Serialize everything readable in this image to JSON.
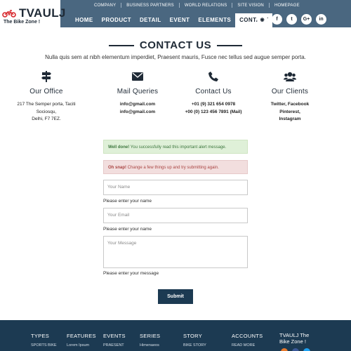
{
  "brand": {
    "name": "TVAULJ",
    "tagline": "The Bike Zone !",
    "brand_color": "#d7262b"
  },
  "top_nav": [
    "COMPANY",
    "BUSINESS PARTNERS",
    "WORLD RELATIONS",
    "SITE VISION",
    "HOMEPAGE"
  ],
  "main_nav": {
    "items": [
      "HOME",
      "PRODUCT",
      "DETAIL",
      "EVENT",
      "ELEMENTS",
      "CONTACT"
    ],
    "active": "CONTACT"
  },
  "social_icons": [
    {
      "name": "rss-icon",
      "glyph": "◉"
    },
    {
      "name": "facebook-icon",
      "glyph": "f"
    },
    {
      "name": "twitter-icon",
      "glyph": "t"
    },
    {
      "name": "google-plus-icon",
      "glyph": "G+"
    },
    {
      "name": "linkedin-icon",
      "glyph": "in"
    }
  ],
  "contact": {
    "title": "CONTACT US",
    "subtitle": "Nulla quis sem at nibh elementum imperdiet, Praesent mauris, Fusce nec tellus sed augue semper porta."
  },
  "info_columns": {
    "office": {
      "title": "Our Office",
      "lines": [
        "217 The Semper porta, Taciti",
        "Sociosqu,",
        "Delhi, F7 7EZ."
      ]
    },
    "mail": {
      "title": "Mail Queries",
      "lines": [
        "info@gmail.com",
        "info@gmail.com"
      ]
    },
    "phone": {
      "title": "Contact Us",
      "lines": [
        "+01 (9) 321 654 0978",
        "+00 (0) 123 456 7891 (Mail)"
      ]
    },
    "clients": {
      "title": "Our Clients",
      "lines": [
        "Twitter, Facebook",
        "Pinterest,",
        "Instagram"
      ]
    }
  },
  "alerts": {
    "success": {
      "strong": "Well done!",
      "text": " You successfully read this important alert message."
    },
    "danger": {
      "strong": "Oh snap!",
      "text": " Change a few things up and try submitting again."
    }
  },
  "form": {
    "name_placeholder": "Your Name",
    "name_help": "Please enter your name",
    "email_placeholder": "Your Email",
    "email_help": "Please enter your name",
    "message_placeholder": "Your Message",
    "message_help": "Please enter your message",
    "submit_label": "Submit"
  },
  "footer": {
    "columns": [
      {
        "heading": "TYPES",
        "first_item": "SPORTS BIKE"
      },
      {
        "heading": "FEATURES",
        "first_item": "Lorem Ipsum"
      },
      {
        "heading": "EVENTS",
        "first_item": "PRAESENT"
      },
      {
        "heading": "SERIES",
        "first_item": "Himenaeos"
      },
      {
        "heading": "STORY",
        "first_item": "BIKE STORY"
      },
      {
        "heading": "ACCOUNTS",
        "first_item": "READ MORE"
      }
    ],
    "brand_line1": "TVAULJ The",
    "brand_line2": "Bike Zone !",
    "dot_colors": [
      "#e8792b",
      "#3b5998",
      "#1da1f2"
    ]
  },
  "colors": {
    "header_bg": "#4a6780",
    "primary_dark": "#1c3a52",
    "success_bg": "#dff0d8",
    "danger_bg": "#f2dede"
  }
}
